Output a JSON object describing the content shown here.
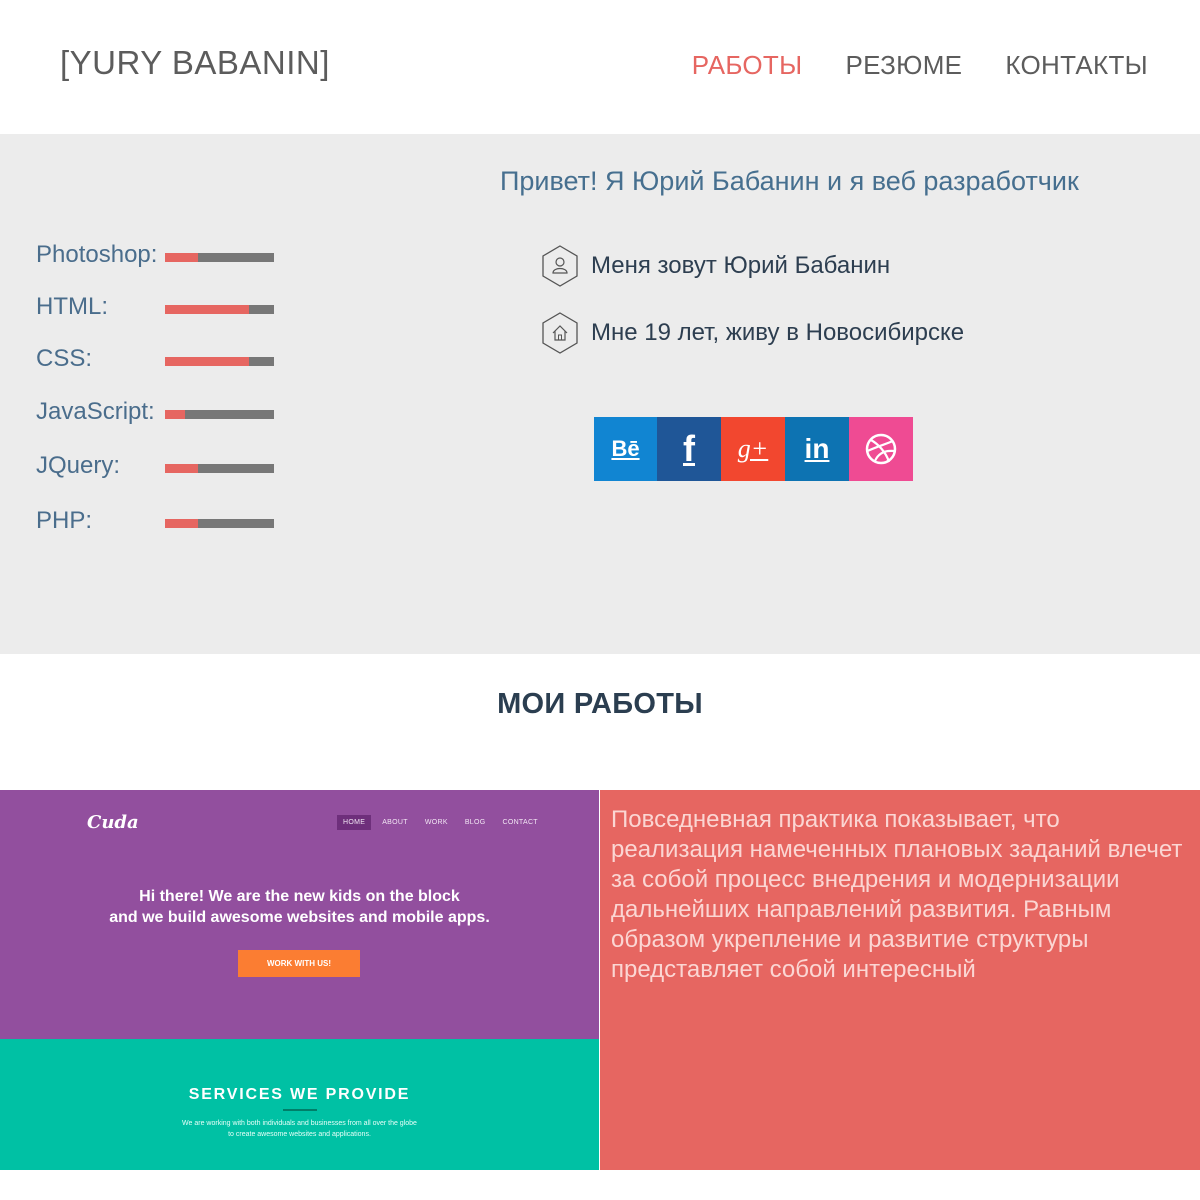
{
  "header": {
    "logo": "[YURY BABANIN]",
    "nav": [
      {
        "label": "РАБОТЫ",
        "active": true
      },
      {
        "label": "РЕЗЮМЕ",
        "active": false
      },
      {
        "label": "КОНТАКТЫ",
        "active": false
      }
    ]
  },
  "hero": {
    "greeting": "Привет! Я Юрий Бабанин и я веб разработчик",
    "skills": [
      {
        "label": "Photoshop:",
        "level": 0.3
      },
      {
        "label": "HTML:",
        "level": 0.77
      },
      {
        "label": "CSS:",
        "level": 0.77
      },
      {
        "label": "JavaScript:",
        "level": 0.18
      },
      {
        "label": "JQuery:",
        "level": 0.3
      },
      {
        "label": "PHP:",
        "level": 0.3
      }
    ],
    "info": [
      {
        "icon": "user-icon",
        "text": "Меня зовут Юрий Бабанин"
      },
      {
        "icon": "home-icon",
        "text": "Мне 19 лет, живу в Новосибирске"
      }
    ],
    "socials": [
      {
        "name": "behance",
        "label": "Bē",
        "color": "#1185d2"
      },
      {
        "name": "facebook",
        "label": "f",
        "color": "#1f5697"
      },
      {
        "name": "google-plus",
        "label": "g+",
        "color": "#f2472f"
      },
      {
        "name": "linkedin",
        "label": "in",
        "color": "#0d73b2"
      },
      {
        "name": "dribbble",
        "label": "",
        "color": "#ef4b93"
      }
    ]
  },
  "works": {
    "title": "МОИ РАБОТЫ",
    "preview": {
      "logo": "Cuda",
      "nav": [
        "HOME",
        "ABOUT",
        "WORK",
        "BLOG",
        "CONTACT"
      ],
      "hero_line1": "Hi there! We are the new kids on the block",
      "hero_line2": "and we build awesome websites and mobile apps.",
      "button": "WORK WITH US!",
      "services_title": "SERVICES WE PROVIDE",
      "services_line1": "We are working with both individuals and businesses from all over the globe",
      "services_line2": "to create awesome websites and applications."
    },
    "description": "Повседневная практика показывает, что реализация намеченных плановых заданий влечет за собой процесс внедрения и модернизации дальнейших направлений развития. Равным образом укрепление и развитие структуры представляет собой интересный"
  },
  "colors": {
    "accent": "#e66661",
    "text_blue": "#466f8f",
    "hero_bg": "#ececec",
    "purple": "#924f9e",
    "teal": "#00c1a4"
  }
}
